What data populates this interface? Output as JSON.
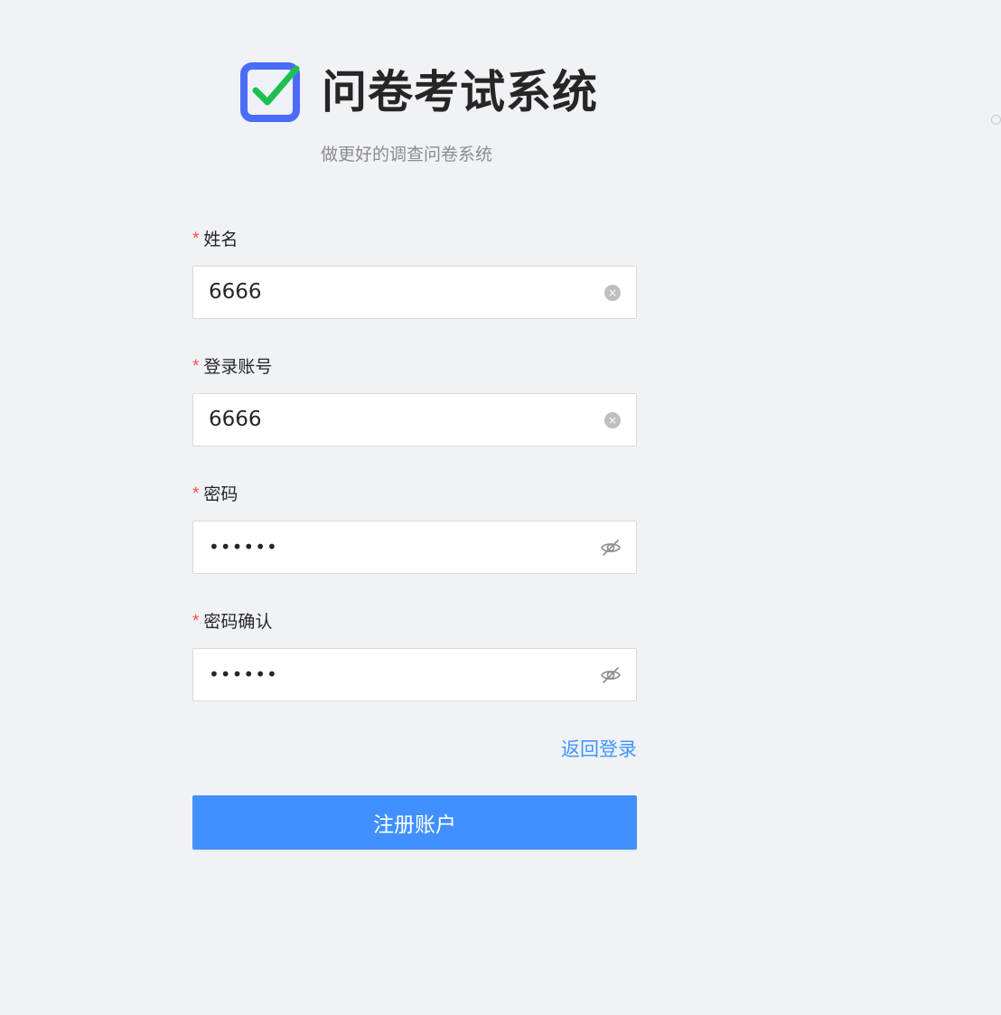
{
  "app": {
    "title": "问卷考试系统",
    "subtitle": "做更好的调查问卷系统",
    "logo_icon": "checkbox-check-icon",
    "logo_colors": {
      "frame": "#4b6cf7",
      "check": "#1fbf4f"
    }
  },
  "form": {
    "fields": [
      {
        "label": "姓名",
        "required_mark": "*",
        "value": "6666",
        "type": "text",
        "action_icon": "clear-icon",
        "action_glyph": "×"
      },
      {
        "label": "登录账号",
        "required_mark": "*",
        "value": "6666",
        "type": "text",
        "action_icon": "clear-icon",
        "action_glyph": "×"
      },
      {
        "label": "密码",
        "required_mark": "*",
        "value": "••••••",
        "type": "password",
        "action_icon": "eye-invisible-icon"
      },
      {
        "label": "密码确认",
        "required_mark": "*",
        "value": "••••••",
        "type": "password",
        "action_icon": "eye-invisible-icon"
      }
    ],
    "back_link_label": "返回登录",
    "submit_label": "注册账户"
  },
  "colors": {
    "background": "#f0f2f5",
    "primary": "#4090ff",
    "link": "#4096ff",
    "required": "#ff4d4f"
  }
}
